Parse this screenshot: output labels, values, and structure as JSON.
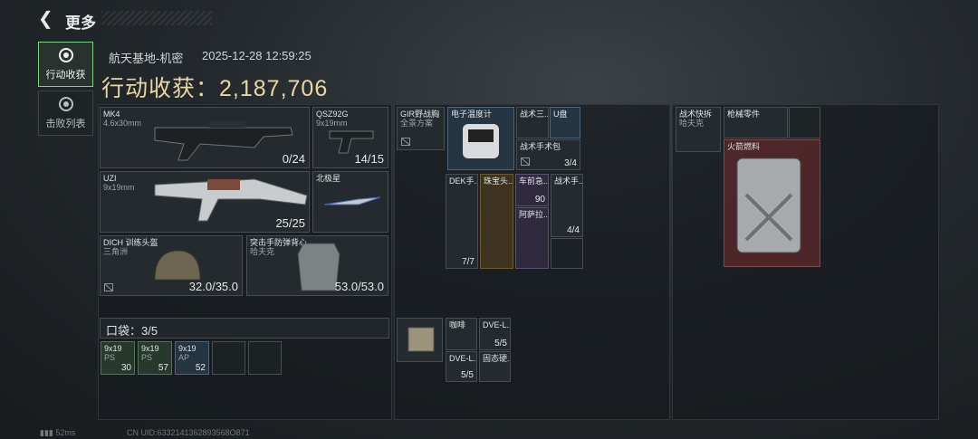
{
  "header": {
    "back_icon": "chevron-left-icon",
    "title": "更多"
  },
  "nav": [
    {
      "label": "行动收获",
      "icon": "target-icon",
      "active": true
    },
    {
      "label": "击败列表",
      "icon": "skull-icon",
      "active": false
    }
  ],
  "info": {
    "location": "航天基地-机密",
    "time": "2025-12-28 12:59:25",
    "gain_label": "行动收获：",
    "gain_value": "2,187,706"
  },
  "equipment": {
    "mk4": {
      "name": "MK4",
      "ammo": "4.6x30mm",
      "count": "0/24"
    },
    "qsz": {
      "name": "QSZ92G",
      "ammo": "9x19mm",
      "count": "14/15"
    },
    "uzi": {
      "name": "UZI",
      "ammo": "9x19mm",
      "count": "25/25"
    },
    "knife": {
      "name": "北极星"
    },
    "helmet": {
      "name": "DICH 训练头盔",
      "sub": "三角洲",
      "count": "32.0/35.0"
    },
    "armor": {
      "name": "突击手防弹背心",
      "sub": "哈夫克",
      "count": "53.0/53.0"
    }
  },
  "pocket": {
    "label": "口袋：3/5",
    "items": [
      {
        "name": "9x19",
        "sub": "PS",
        "count": "30"
      },
      {
        "name": "9x19",
        "sub": "PS",
        "count": "57"
      },
      {
        "name": "9x19",
        "sub": "AP",
        "count": "52"
      }
    ]
  },
  "backpack": {
    "chest": {
      "name": "GIR野战胸",
      "sub": "全景方案"
    },
    "thermo": {
      "name": "电子温度计"
    },
    "tactical3": {
      "name": "战术三..."
    },
    "udisk": {
      "name": "U盘"
    },
    "tac_pack": {
      "name": "战术手术包",
      "count": "3/4"
    },
    "dek": {
      "name": "DEK手...",
      "count": "7/7"
    },
    "jewel": {
      "name": "珠宝头..."
    },
    "car": {
      "name": "车前急...",
      "count": "90"
    },
    "asa": {
      "name": "阿萨拉..."
    },
    "tac_hand": {
      "name": "战术手...",
      "count": "4/4"
    }
  },
  "case": {
    "coffee": {
      "name": "咖啡"
    },
    "dve1": {
      "name": "DVE-L...",
      "count": "5/5"
    },
    "dve2": {
      "name": "DVE-L...",
      "count": "5/5"
    },
    "solid": {
      "name": "固态硬..."
    }
  },
  "safebox": {
    "tac_cut": {
      "name": "战术快拆",
      "sub": "哈夫克"
    },
    "gun_parts": {
      "name": "枪械零件"
    },
    "fuel": {
      "name": "火箭燃料"
    }
  },
  "footer": {
    "ping": "52ms",
    "uid": "CN UID:6332141362893568O871"
  },
  "colors": {
    "gain": "#e9d6a0",
    "active": "#74d884"
  }
}
